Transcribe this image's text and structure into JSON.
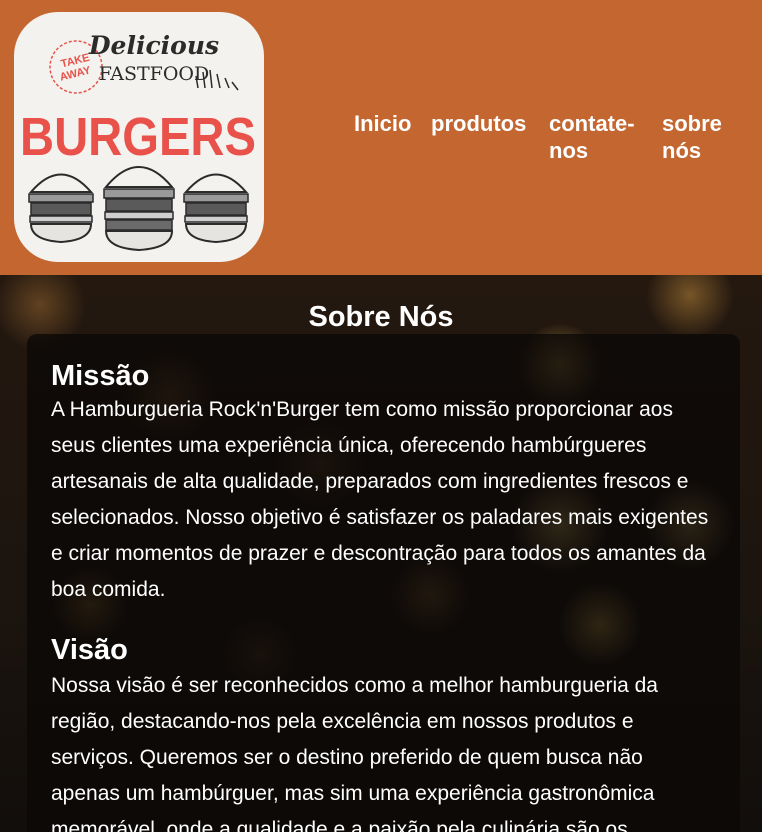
{
  "logo": {
    "line1": "Delicious",
    "line2": "FASTFOOD",
    "badge_top": "TAKE",
    "badge_bottom": "AWAY",
    "big_word": "BURGERS"
  },
  "nav": {
    "items": [
      {
        "label": "Inicio"
      },
      {
        "label": "produtos"
      },
      {
        "label": "contate-\nnos"
      },
      {
        "label": "sobre\nnós"
      }
    ]
  },
  "main": {
    "title": "Sobre Nós",
    "missao": {
      "heading": "Missão",
      "text": "A Hamburgueria Rock'n'Burger tem como missão proporcionar aos seus clientes uma experiência única, oferecendo hambúrgueres artesanais de alta qualidade, preparados com ingredientes frescos e selecionados. Nosso objetivo é satisfazer os paladares mais exigentes e criar momentos de prazer e descontração para todos os amantes da boa comida."
    },
    "visao": {
      "heading": "Visão",
      "text": "Nossa visão é ser reconhecidos como a melhor hamburgueria da região, destacando-nos pela excelência em nossos produtos e serviços. Queremos ser o destino preferido de quem busca não apenas um hambúrguer, mas sim uma experiência gastronômica memorável, onde a qualidade e a paixão pela culinária são os"
    }
  },
  "colors": {
    "header_bg": "#c3662f",
    "logo_red": "#e8524a",
    "text": "#ffffff"
  }
}
